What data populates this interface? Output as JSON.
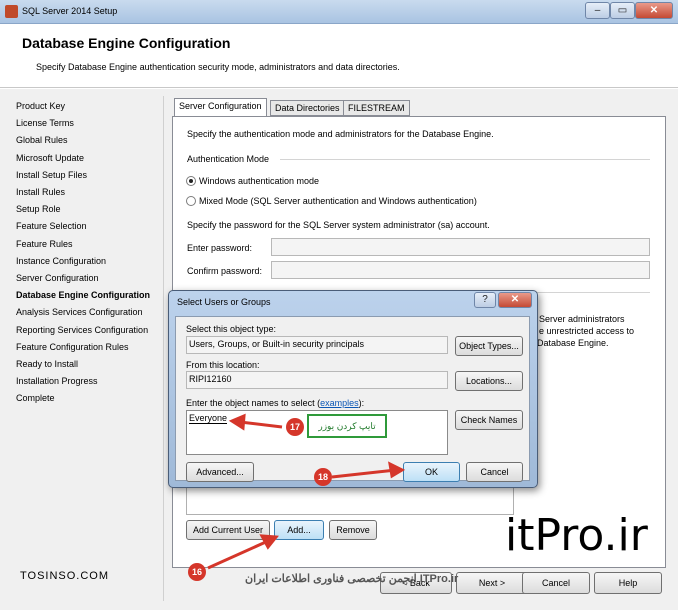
{
  "window": {
    "title": "SQL Server 2014 Setup"
  },
  "header": {
    "title": "Database Engine Configuration",
    "subtitle": "Specify Database Engine authentication security mode, administrators and data directories."
  },
  "nav": [
    "Product Key",
    "License Terms",
    "Global Rules",
    "Microsoft Update",
    "Install Setup Files",
    "Install Rules",
    "Setup Role",
    "Feature Selection",
    "Feature Rules",
    "Instance Configuration",
    "Server Configuration",
    "Database Engine Configuration",
    "Analysis Services Configuration",
    "Reporting Services Configuration",
    "Feature Configuration Rules",
    "Ready to Install",
    "Installation Progress",
    "Complete"
  ],
  "nav_active": "Database Engine Configuration",
  "tabs": [
    "Server Configuration",
    "Data Directories",
    "FILESTREAM"
  ],
  "server_config": {
    "intro": "Specify the authentication mode and administrators for the Database Engine.",
    "auth_heading": "Authentication Mode",
    "opt_windows": "Windows authentication mode",
    "opt_mixed": "Mixed Mode (SQL Server authentication and Windows authentication)",
    "sa_text": "Specify the password for the SQL Server system administrator (sa) account.",
    "enter_password": "Enter password:",
    "confirm_password": "Confirm password:",
    "admins_text_1": "Server administrators",
    "admins_text_2": "e unrestricted access to",
    "admins_text_3": "Database Engine.",
    "btn_add_current": "Add Current User",
    "btn_add": "Add...",
    "btn_remove": "Remove"
  },
  "dialog": {
    "title": "Select Users or Groups",
    "help": "?",
    "close": "✕",
    "object_type_label": "Select this object type:",
    "object_type_value": "Users, Groups, or Built-in security principals",
    "btn_object_types": "Object Types...",
    "location_label": "From this location:",
    "location_value": "RIPI12160",
    "btn_locations": "Locations...",
    "names_label_pre": "Enter the object names to select (",
    "names_label_link": "examples",
    "names_label_post": "):",
    "names_value": "Everyone",
    "btn_check_names": "Check Names",
    "btn_advanced": "Advanced...",
    "btn_ok": "OK",
    "btn_cancel": "Cancel"
  },
  "footer": {
    "btn_back": "< Back",
    "btn_next": "Next >",
    "btn_cancel": "Cancel",
    "btn_help": "Help"
  },
  "annotations": {
    "c16": "16",
    "c17": "17",
    "c18": "18",
    "type_user": "تایپ کردن یوزر"
  },
  "watermarks": {
    "itpro": "itPro.ir",
    "tosinso": "TOSINSO.COM",
    "persian": "انجمن تخصصی فناوری اطلاعات ایران ITPro.ir"
  },
  "colors": {
    "accent": "#3c7fb1",
    "callout": "#d5362a",
    "note_border": "#2f9a3a"
  }
}
